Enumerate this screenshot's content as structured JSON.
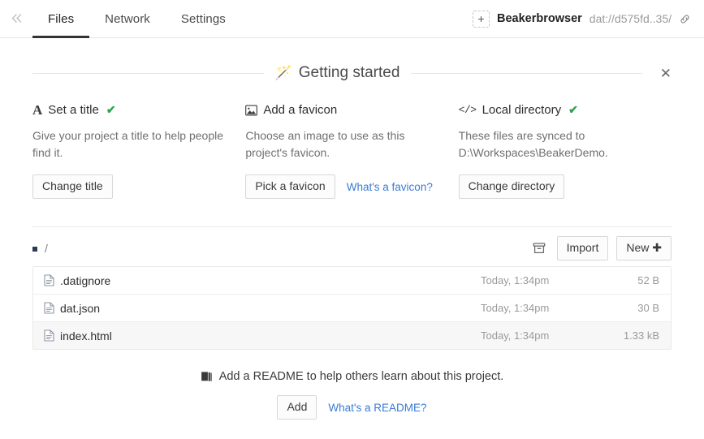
{
  "topbar": {
    "collapse_icon": "chevron-double-left-icon",
    "tabs": [
      {
        "label": "Files",
        "active": true
      },
      {
        "label": "Network",
        "active": false
      },
      {
        "label": "Settings",
        "active": false
      }
    ],
    "add_favicon_glyph": "+",
    "site_title": "Beakerbrowser",
    "site_url": "dat://d575fd..35/",
    "link_icon": "chain-link-icon"
  },
  "getting_started": {
    "wand_icon": "🪄",
    "title": "Getting started",
    "close_label": "✕",
    "columns": [
      {
        "icon": "serif-a-icon",
        "icon_glyph": "A",
        "title": "Set a title",
        "completed": true,
        "check_glyph": "✔",
        "description": "Give your project a title to help people find it.",
        "button": "Change title",
        "link": ""
      },
      {
        "icon": "image-icon",
        "icon_glyph": "",
        "title": "Add a favicon",
        "completed": false,
        "check_glyph": "",
        "description": "Choose an image to use as this project's favicon.",
        "button": "Pick a favicon",
        "link": "What's a favicon?"
      },
      {
        "icon": "code-brackets-icon",
        "icon_glyph": "</>",
        "title": "Local directory",
        "completed": true,
        "check_glyph": "✔",
        "description": "These files are synced to D:\\Workspaces\\BeakerDemo.",
        "button": "Change directory",
        "link": ""
      }
    ]
  },
  "files": {
    "breadcrumb_root": "/",
    "archive_icon": "archive-box-icon",
    "import_label": "Import",
    "new_label": "New",
    "new_plus": "✚",
    "rows": [
      {
        "icon": "file-icon",
        "name": ".datignore",
        "date": "Today, 1:34pm",
        "size": "52 B",
        "hover": false
      },
      {
        "icon": "file-icon",
        "name": "dat.json",
        "date": "Today, 1:34pm",
        "size": "30 B",
        "hover": false
      },
      {
        "icon": "file-icon",
        "name": "index.html",
        "date": "Today, 1:34pm",
        "size": "1.33 kB",
        "hover": true
      }
    ]
  },
  "readme": {
    "book_icon": "book-icon",
    "text": "Add a README to help others learn about this project.",
    "add_label": "Add",
    "link": "What's a README?"
  },
  "colors": {
    "accent_link": "#3a7bd5",
    "check_green": "#2aa44f",
    "active_tab_underline": "#333333",
    "bullet": "#2b3a55"
  }
}
